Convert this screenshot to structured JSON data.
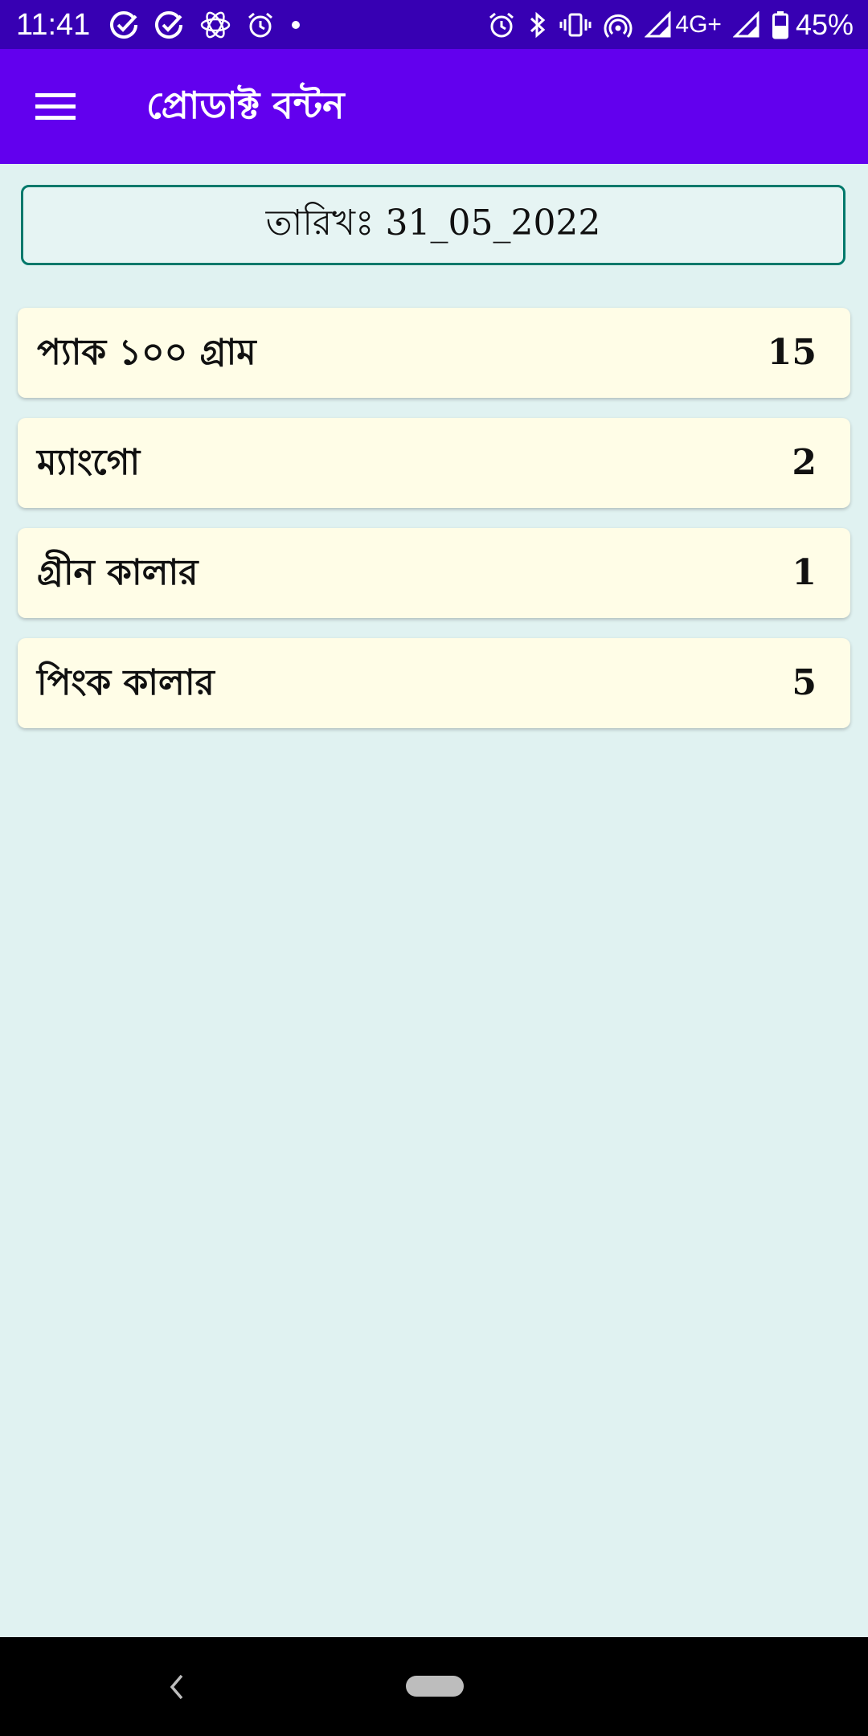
{
  "status_bar": {
    "time": "11:41",
    "left_icons": [
      "check-circle-icon",
      "check-circle-icon",
      "atom-icon",
      "alarm-icon",
      "dot-icon"
    ],
    "right_icons": [
      "alarm-icon",
      "bluetooth-icon",
      "vibrate-icon",
      "hotspot-icon",
      "signal-icon",
      "signal-icon",
      "battery-icon"
    ],
    "network": "4G+",
    "battery": "45%"
  },
  "app_bar": {
    "title": "প্রোডাক্ট বন্টন",
    "menu_icon": "hamburger-menu-icon"
  },
  "date_label": "তারিখঃ 31_05_2022",
  "products": [
    {
      "name": "প্যাক ১০০ গ্রাম",
      "qty": "15"
    },
    {
      "name": "ম্যাংগো",
      "qty": "2"
    },
    {
      "name": "গ্রীন কালার",
      "qty": "1"
    },
    {
      "name": "পিংক কালার",
      "qty": "5"
    }
  ],
  "nav_bar": {
    "back_icon": "back-chevron-icon",
    "home_icon": "home-pill-icon"
  },
  "colors": {
    "status_bar": "#3700b3",
    "app_bar": "#6200ee",
    "background": "#e0f2f1",
    "card": "#fffde7",
    "date_border": "#00796b"
  }
}
